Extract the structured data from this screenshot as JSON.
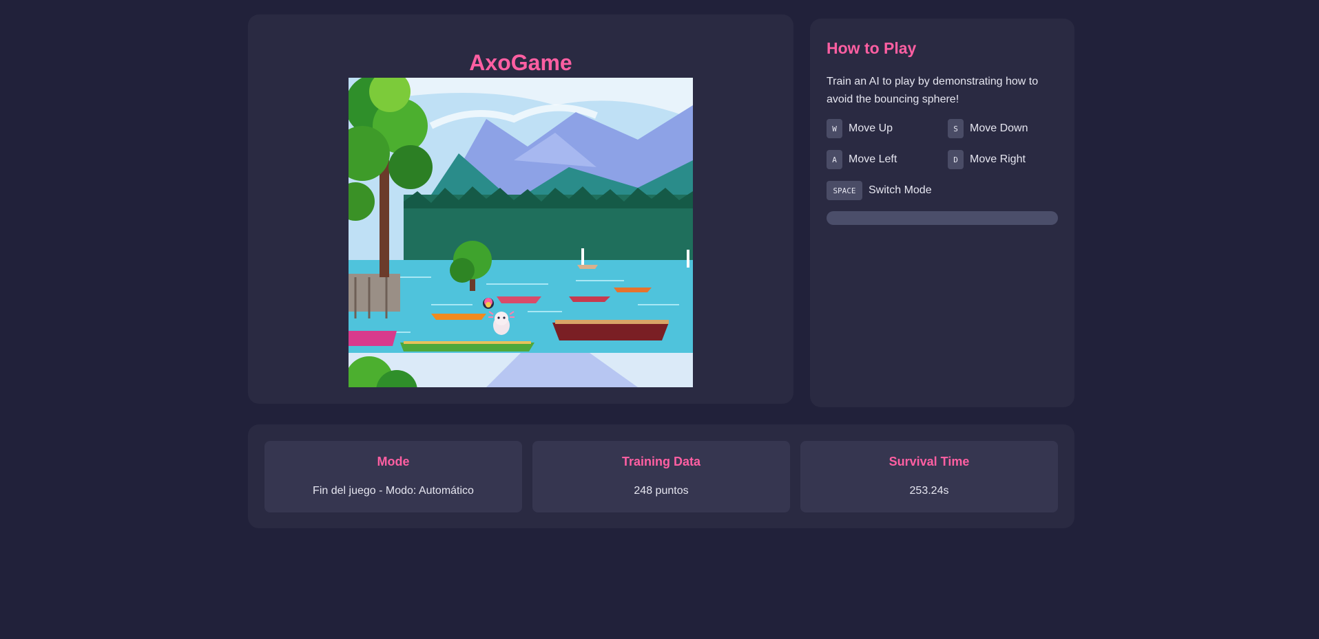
{
  "game": {
    "title": "AxoGame"
  },
  "help": {
    "title": "How to Play",
    "description": "Train an AI to play by demonstrating how to avoid the bouncing sphere!",
    "controls": [
      {
        "key": "W",
        "label": "Move Up"
      },
      {
        "key": "S",
        "label": "Move Down"
      },
      {
        "key": "A",
        "label": "Move Left"
      },
      {
        "key": "D",
        "label": "Move Right"
      },
      {
        "key": "SPACE",
        "label": "Switch Mode"
      }
    ],
    "progress_percent": 0
  },
  "stats": [
    {
      "title": "Mode",
      "value": "Fin del juego - Modo: Automático"
    },
    {
      "title": "Training Data",
      "value": "248 puntos"
    },
    {
      "title": "Survival Time",
      "value": "253.24s"
    }
  ],
  "colors": {
    "accent": "#ff5fa2",
    "background": "#21213a",
    "panel": "#2a2a42",
    "card": "#363650"
  }
}
